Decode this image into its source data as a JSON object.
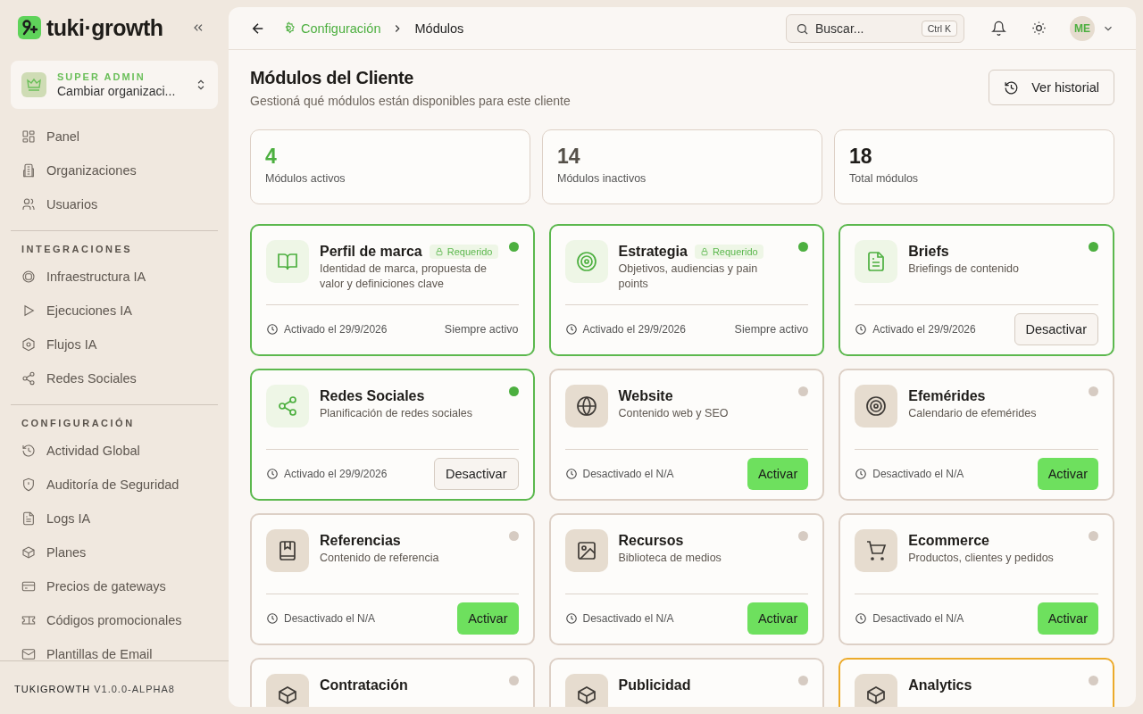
{
  "sidebar": {
    "brand": "tuki·growth",
    "org_switcher": {
      "role": "SUPER ADMIN",
      "label": "Cambiar organizaci..."
    },
    "sections": [
      {
        "items": [
          {
            "label": "Panel"
          },
          {
            "label": "Organizaciones"
          },
          {
            "label": "Usuarios"
          }
        ]
      },
      {
        "heading": "INTEGRACIONES",
        "items": [
          {
            "label": "Infraestructura IA"
          },
          {
            "label": "Ejecuciones IA"
          },
          {
            "label": "Flujos IA"
          },
          {
            "label": "Redes Sociales"
          }
        ]
      },
      {
        "heading": "CONFIGURACIÓN",
        "items": [
          {
            "label": "Actividad Global"
          },
          {
            "label": "Auditoría de Seguridad"
          },
          {
            "label": "Logs IA"
          },
          {
            "label": "Planes"
          },
          {
            "label": "Precios de gateways"
          },
          {
            "label": "Códigos promocionales"
          },
          {
            "label": "Plantillas de Email"
          }
        ]
      }
    ],
    "footer": {
      "brand": "TUKIGROWTH",
      "version": "V1.0.0-ALPHA8"
    }
  },
  "header": {
    "breadcrumb": [
      {
        "label": "Configuración",
        "selected": false
      },
      {
        "label": "Módulos",
        "selected": true
      }
    ],
    "search": {
      "placeholder": "Buscar...",
      "shortcut": "Ctrl K"
    },
    "avatar": "ME"
  },
  "page": {
    "title": "Módulos del Cliente",
    "subtitle": "Gestioná qué módulos están disponibles para este cliente",
    "history_button": "Ver historial"
  },
  "stats": [
    {
      "value": "4",
      "label": "Módulos activos",
      "kind": "active"
    },
    {
      "value": "14",
      "label": "Módulos inactivos",
      "kind": "inactive"
    },
    {
      "value": "18",
      "label": "Total módulos",
      "kind": "total"
    }
  ],
  "modules": [
    {
      "title": "Perfil de marca",
      "description": "Identidad de marca, propuesta de valor y definiciones clave",
      "badge": "Requerido",
      "active": true,
      "highlighted": false,
      "status_text": "Activado el 29/9/2026",
      "action": {
        "kind": "note",
        "label": "Siempre activo"
      }
    },
    {
      "title": "Estrategia",
      "description": "Objetivos, audiencias y pain points",
      "badge": "Requerido",
      "active": true,
      "highlighted": false,
      "status_text": "Activado el 29/9/2026",
      "action": {
        "kind": "note",
        "label": "Siempre activo"
      }
    },
    {
      "title": "Briefs",
      "description": "Briefings de contenido",
      "active": true,
      "highlighted": false,
      "status_text": "Activado el 29/9/2026",
      "action": {
        "kind": "deactivate",
        "label": "Desactivar"
      }
    },
    {
      "title": "Redes Sociales",
      "description": "Planificación de redes sociales",
      "active": true,
      "highlighted": false,
      "status_text": "Activado el 29/9/2026",
      "action": {
        "kind": "deactivate",
        "label": "Desactivar"
      }
    },
    {
      "title": "Website",
      "description": "Contenido web y SEO",
      "active": false,
      "highlighted": false,
      "status_text": "Desactivado el N/A",
      "action": {
        "kind": "activate",
        "label": "Activar"
      }
    },
    {
      "title": "Efemérides",
      "description": "Calendario de efemérides",
      "active": false,
      "highlighted": false,
      "status_text": "Desactivado el N/A",
      "action": {
        "kind": "activate",
        "label": "Activar"
      }
    },
    {
      "title": "Referencias",
      "description": "Contenido de referencia",
      "active": false,
      "highlighted": false,
      "status_text": "Desactivado el N/A",
      "action": {
        "kind": "activate",
        "label": "Activar"
      }
    },
    {
      "title": "Recursos",
      "description": "Biblioteca de medios",
      "active": false,
      "highlighted": false,
      "status_text": "Desactivado el N/A",
      "action": {
        "kind": "activate",
        "label": "Activar"
      }
    },
    {
      "title": "Ecommerce",
      "description": "Productos, clientes y pedidos",
      "active": false,
      "highlighted": false,
      "status_text": "Desactivado el N/A",
      "action": {
        "kind": "activate",
        "label": "Activar"
      }
    },
    {
      "title": "Contratación",
      "active": false,
      "highlighted": false
    },
    {
      "title": "Publicidad",
      "active": false,
      "highlighted": false
    },
    {
      "title": "Analytics",
      "active": false,
      "highlighted": true
    }
  ]
}
